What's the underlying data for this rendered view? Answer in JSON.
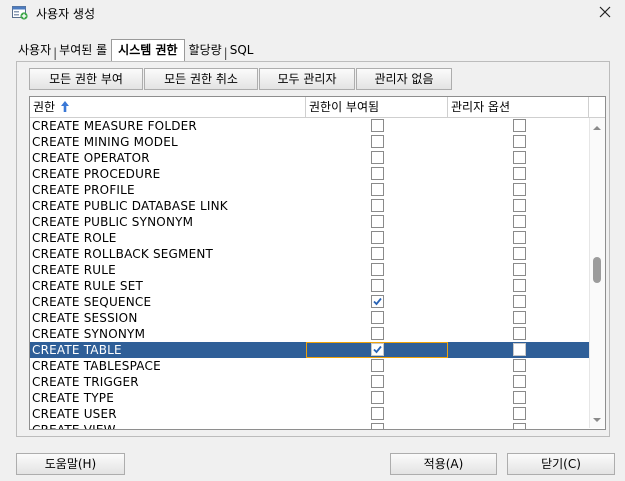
{
  "window": {
    "title": "사용자 생성",
    "close_icon": "close-icon",
    "app_icon": "user-add-icon"
  },
  "tabs": [
    {
      "label": "사용자"
    },
    {
      "label": "부여된 롤"
    },
    {
      "label": "시스템 권한",
      "active": true
    },
    {
      "label": "할당량"
    },
    {
      "label": "SQL"
    }
  ],
  "toolbar": {
    "grant_all": "모든 권한 부여",
    "revoke_all": "모든 권한 취소",
    "all_admin": "모두 관리자",
    "no_admin": "관리자 없음"
  },
  "grid": {
    "columns": [
      "권한",
      "권한이 부여됨",
      "관리자 옵션"
    ],
    "sort_icon": "sort-ascending-icon",
    "rows": [
      {
        "name": "CREATE MEASURE FOLDER",
        "granted": false,
        "admin": false
      },
      {
        "name": "CREATE MINING MODEL",
        "granted": false,
        "admin": false
      },
      {
        "name": "CREATE OPERATOR",
        "granted": false,
        "admin": false
      },
      {
        "name": "CREATE PROCEDURE",
        "granted": false,
        "admin": false
      },
      {
        "name": "CREATE PROFILE",
        "granted": false,
        "admin": false
      },
      {
        "name": "CREATE PUBLIC DATABASE LINK",
        "granted": false,
        "admin": false
      },
      {
        "name": "CREATE PUBLIC SYNONYM",
        "granted": false,
        "admin": false
      },
      {
        "name": "CREATE ROLE",
        "granted": false,
        "admin": false
      },
      {
        "name": "CREATE ROLLBACK SEGMENT",
        "granted": false,
        "admin": false
      },
      {
        "name": "CREATE RULE",
        "granted": false,
        "admin": false
      },
      {
        "name": "CREATE RULE SET",
        "granted": false,
        "admin": false
      },
      {
        "name": "CREATE SEQUENCE",
        "granted": true,
        "admin": false
      },
      {
        "name": "CREATE SESSION",
        "granted": false,
        "admin": false
      },
      {
        "name": "CREATE SYNONYM",
        "granted": false,
        "admin": false
      },
      {
        "name": "CREATE TABLE",
        "granted": true,
        "admin": false,
        "selected": true
      },
      {
        "name": "CREATE TABLESPACE",
        "granted": false,
        "admin": false
      },
      {
        "name": "CREATE TRIGGER",
        "granted": false,
        "admin": false
      },
      {
        "name": "CREATE TYPE",
        "granted": false,
        "admin": false
      },
      {
        "name": "CREATE USER",
        "granted": false,
        "admin": false
      },
      {
        "name": "CREATE VIEW",
        "granted": false,
        "admin": false
      }
    ],
    "scroll_position": 0.47
  },
  "footer": {
    "help": "도움말(H)",
    "apply": "적용(A)",
    "close": "닫기(C)"
  },
  "colors": {
    "selection": "#2f5f98",
    "focus": "#f0a30a",
    "check": "#2a63b5"
  }
}
